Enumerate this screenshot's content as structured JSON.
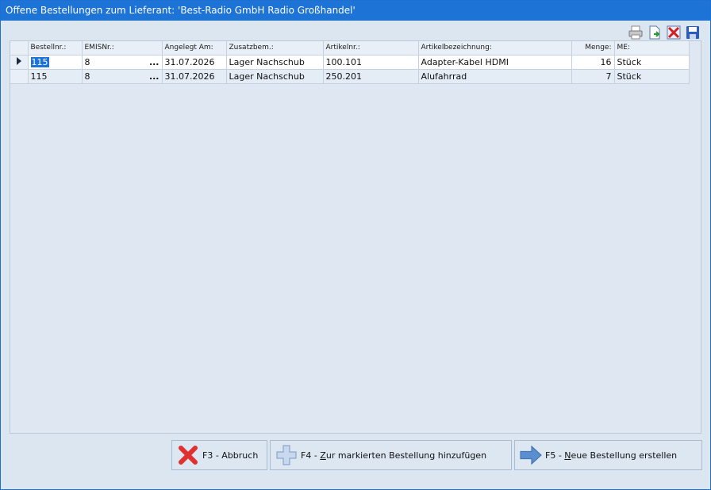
{
  "window": {
    "title": "Offene Bestellungen zum Lieferant: 'Best-Radio GmbH Radio Großhandel'"
  },
  "toolbar": {
    "icons": [
      "printer-icon",
      "export-document-icon",
      "delete-icon",
      "save-icon"
    ]
  },
  "table": {
    "columns": [
      {
        "label": "Bestellnr.:"
      },
      {
        "label": "EMISNr.:"
      },
      {
        "label": "Angelegt Am:"
      },
      {
        "label": "Zusatzbem.:"
      },
      {
        "label": "Artikelnr.:"
      },
      {
        "label": "Artikelbezeichnung:"
      },
      {
        "label": "Menge:"
      },
      {
        "label": "ME:"
      }
    ],
    "rows": [
      {
        "bestellnr": "115",
        "emisnr": "8",
        "ellipsis": "...",
        "angelegt": "31.07.2026",
        "zusatz": "Lager Nachschub",
        "artikelnr": "100.101",
        "bezeichnung": "Adapter-Kabel HDMI",
        "menge": "16",
        "me": "Stück"
      },
      {
        "bestellnr": "115",
        "emisnr": "8",
        "ellipsis": "...",
        "angelegt": "31.07.2026",
        "zusatz": "Lager Nachschub",
        "artikelnr": "250.201",
        "bezeichnung": "Alufahrrad",
        "menge": "7",
        "me": "Stück"
      }
    ]
  },
  "buttons": {
    "cancel": {
      "prefix": "F3 - ",
      "label": "Abbruch"
    },
    "add_to_order": {
      "prefix": "F4 - ",
      "mnemonic": "Z",
      "label": "ur markierten Bestellung hinzufügen"
    },
    "new_order": {
      "prefix": "F5 - ",
      "mnemonic": "N",
      "label": "eue Bestellung erstellen"
    }
  }
}
